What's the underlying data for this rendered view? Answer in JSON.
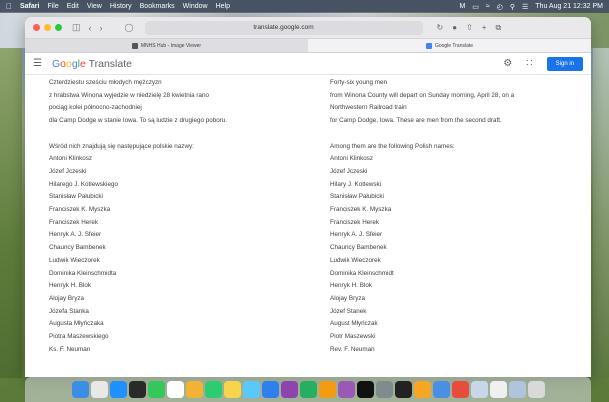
{
  "menubar": {
    "app": "Safari",
    "items": [
      "File",
      "Edit",
      "View",
      "History",
      "Bookmarks",
      "Window",
      "Help"
    ],
    "clock": "Thu Aug 21  12:32 PM"
  },
  "browser": {
    "url": "translate.google.com",
    "tabs": [
      {
        "label": "MNHS Hub - Image Viewer",
        "active": false
      },
      {
        "label": "Google Translate",
        "active": true
      }
    ]
  },
  "translate": {
    "logo": "Google Translate",
    "sign_in": "Sign in",
    "source_lines": [
      "Czterdziestu sześciu młodych mężczyzn",
      "z hrabstwa Winona wyjedzie w niedzielę 28 kwietnia rano",
      "pociąg kolei północno-zachodniej",
      "dla Camp Dodge w stanie Iowa. To są ludzie z drugiego poboru.",
      "",
      "Wśród nich znajdują się następujące polskie nazwy:",
      "Antoni Klinkosz",
      "Józef Jczeski",
      "Hilarego J. Kotlewskiego",
      "Stanisław Pałubicki",
      "Franciszek K. Myszka",
      "Franciszek Herek",
      "Henryk A. J. Sfeier",
      "Chauncy Bambenek",
      "Ludwik Wieczorek",
      "Dominika Kleinschmidta",
      "Henryk H. Blok",
      "Alojay Bryza",
      "Józefa Stanka",
      "Augusta Młyńczaka",
      "Piotra Maszewskiego",
      "Ks. F. Neuman"
    ],
    "target_lines": [
      "Forty-six young men",
      "from Winona County will depart on Sunday morning, April 28, on a",
      "Northwestern Railroad train",
      "for Camp Dodge, Iowa. These are men from the second draft.",
      "",
      "Among them are the following Polish names:",
      "Antoni Klinkosz",
      "Józef Jczeski",
      "Hilary J. Kotlewski",
      "Stanisław Pałubicki",
      "Franciszek K. Myszka",
      "Franciszek Herek",
      "Henryk A. J. Sfeier",
      "Chauncy Bambenek",
      "Ludwik Wieczorek",
      "Dominika Kleinschmidt",
      "Henryk H. Blok",
      "Alojay Bryza",
      "Józef Stanek",
      "August Młyńczak",
      "Piotr Maszewski",
      "Rev. F. Neuman"
    ]
  },
  "colors": {
    "google_blue": "#4285f4",
    "google_red": "#ea4335",
    "google_yellow": "#fbbc05",
    "google_green": "#34a853",
    "sign_in_bg": "#1a73e8"
  },
  "dock_icons": [
    "finder-icon",
    "launchpad-icon",
    "safari-icon",
    "app-icon",
    "messages-icon",
    "calendar-icon",
    "photos-icon",
    "facetime-icon",
    "notes-icon",
    "maps-icon",
    "mail-icon",
    "app-icon",
    "numbers-icon",
    "pages-icon",
    "podcasts-icon",
    "tv-icon",
    "settings-icon",
    "app-icon",
    "app-icon",
    "app-icon",
    "news-icon",
    "preview-icon",
    "documents-icon",
    "folder-icon",
    "trash-icon"
  ]
}
